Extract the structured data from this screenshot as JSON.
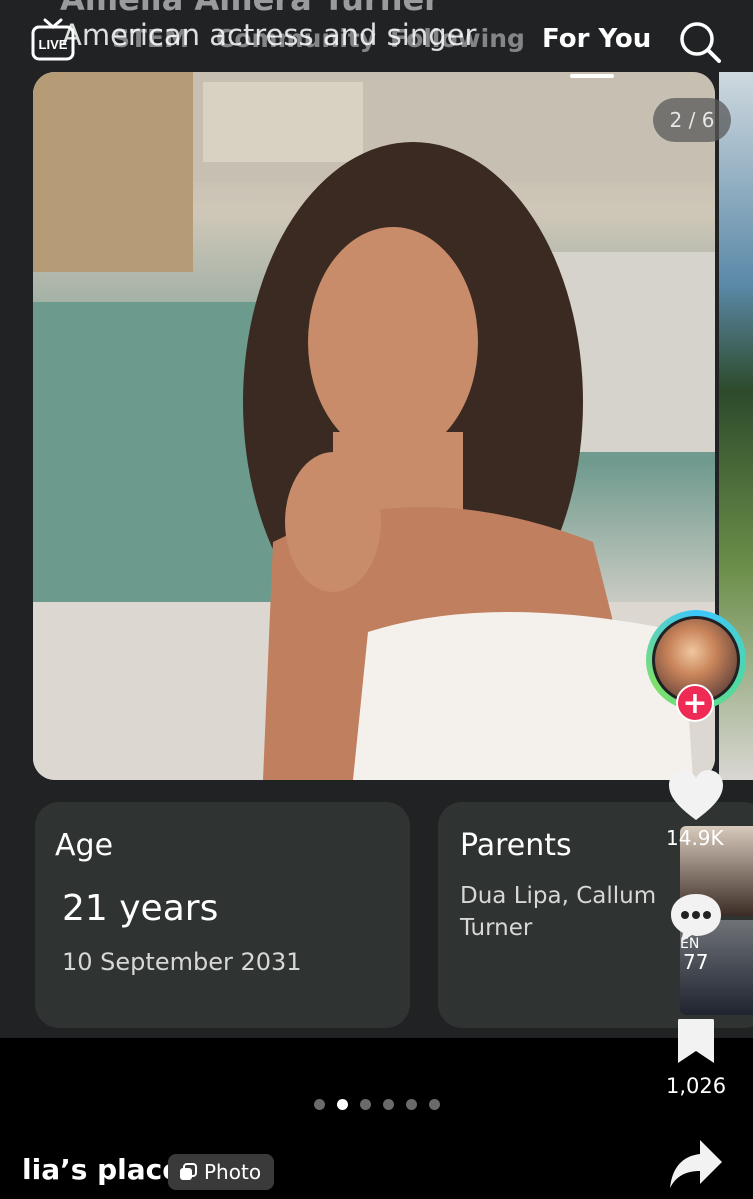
{
  "header": {
    "title_fragment": "Amelia Amera Turner",
    "subtitle": "American actress and singer",
    "live_label": "LIVE",
    "tabs": [
      {
        "label": "STEM"
      },
      {
        "label": "Community"
      },
      {
        "label": "Following"
      },
      {
        "label": "For You"
      }
    ]
  },
  "photo": {
    "counter": "2 / 6"
  },
  "cards": {
    "age": {
      "heading": "Age",
      "value": "21 years",
      "date": "10 September 2031"
    },
    "parents": {
      "heading": "Parents",
      "value": "Dua Lipa, Callum Turner"
    },
    "thumb_label": "EN"
  },
  "actions": {
    "likes": "14.9K",
    "comments": "77",
    "saves": "1,026"
  },
  "pagination": {
    "total": 6,
    "active_index": 1
  },
  "footer": {
    "username": "lia’s place",
    "badge": "Photo"
  },
  "colors": {
    "background": "#202224",
    "accent_follow": "#ef2b55",
    "card": "#2f3331"
  }
}
